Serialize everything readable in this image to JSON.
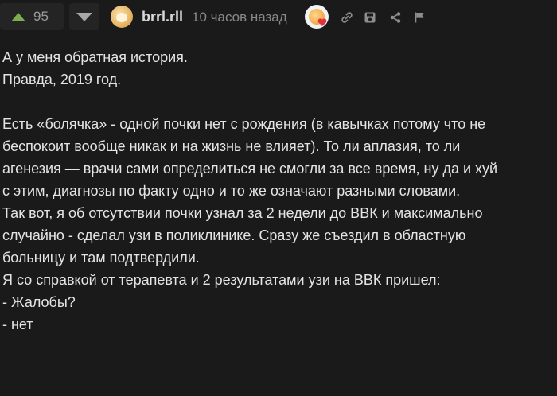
{
  "header": {
    "upvote_count": "95",
    "username": "brrl.rll",
    "timestamp": "10 часов назад",
    "colors": {
      "upvote_arrow": "#7dac4e",
      "background": "#1a1a1a",
      "text": "#e4e4e4",
      "muted": "#8a8a8a"
    },
    "icons": [
      "arrow-up-icon",
      "arrow-down-icon",
      "avatar",
      "award-badge",
      "link-icon",
      "save-icon",
      "share-icon",
      "flag-icon"
    ]
  },
  "comment": {
    "lines": [
      "А у меня обратная история.",
      "Правда, 2019 год.",
      "",
      "Есть «болячка» - одной почки нет с рождения (в кавычках потому что не",
      "беспокоит вообще никак и на жизнь не влияет). То ли аплазия, то ли",
      "агенезия — врачи сами определиться не смогли за все время, ну да и хуй",
      "с этим, диагнозы по факту одно и то же означают разными словами.",
      "Так вот, я об отсутствии почки узнал за 2 недели до ВВК и максимально",
      "случайно - сделал узи в поликлинике. Сразу же съездил в областную",
      "больницу и там подтвердили.",
      "Я со справкой от терапевта и 2 результатами узи на ВВК пришел:",
      "- Жалобы?",
      "- нет"
    ]
  }
}
